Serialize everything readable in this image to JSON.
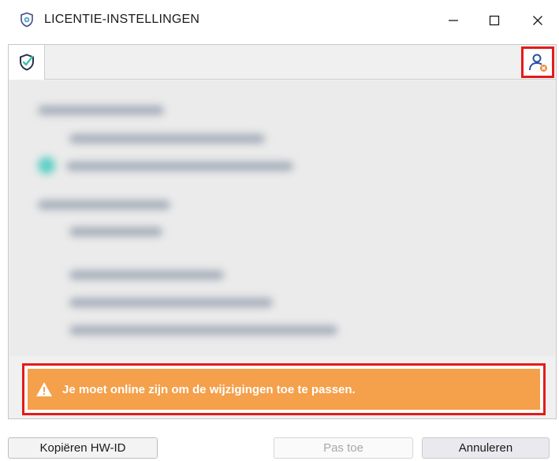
{
  "window": {
    "title": "LICENTIE-INSTELLINGEN",
    "controls": [
      "minimize-icon",
      "maximize-icon",
      "close-icon"
    ]
  },
  "toolbar": {
    "tab_icon": "shield-check-icon",
    "user_icon": "user-error-icon"
  },
  "warning": {
    "icon": "warning-triangle-icon",
    "message": "Je moet online zijn om de wijzigingen toe te passen."
  },
  "buttons": {
    "copy_hwid": "Kopiëren HW-ID",
    "apply": "Pas toe",
    "cancel": "Annuleren"
  },
  "colors": {
    "warning_bg": "#f5a04a",
    "highlight": "#e31b1b",
    "accent": "#2b4ea8"
  }
}
